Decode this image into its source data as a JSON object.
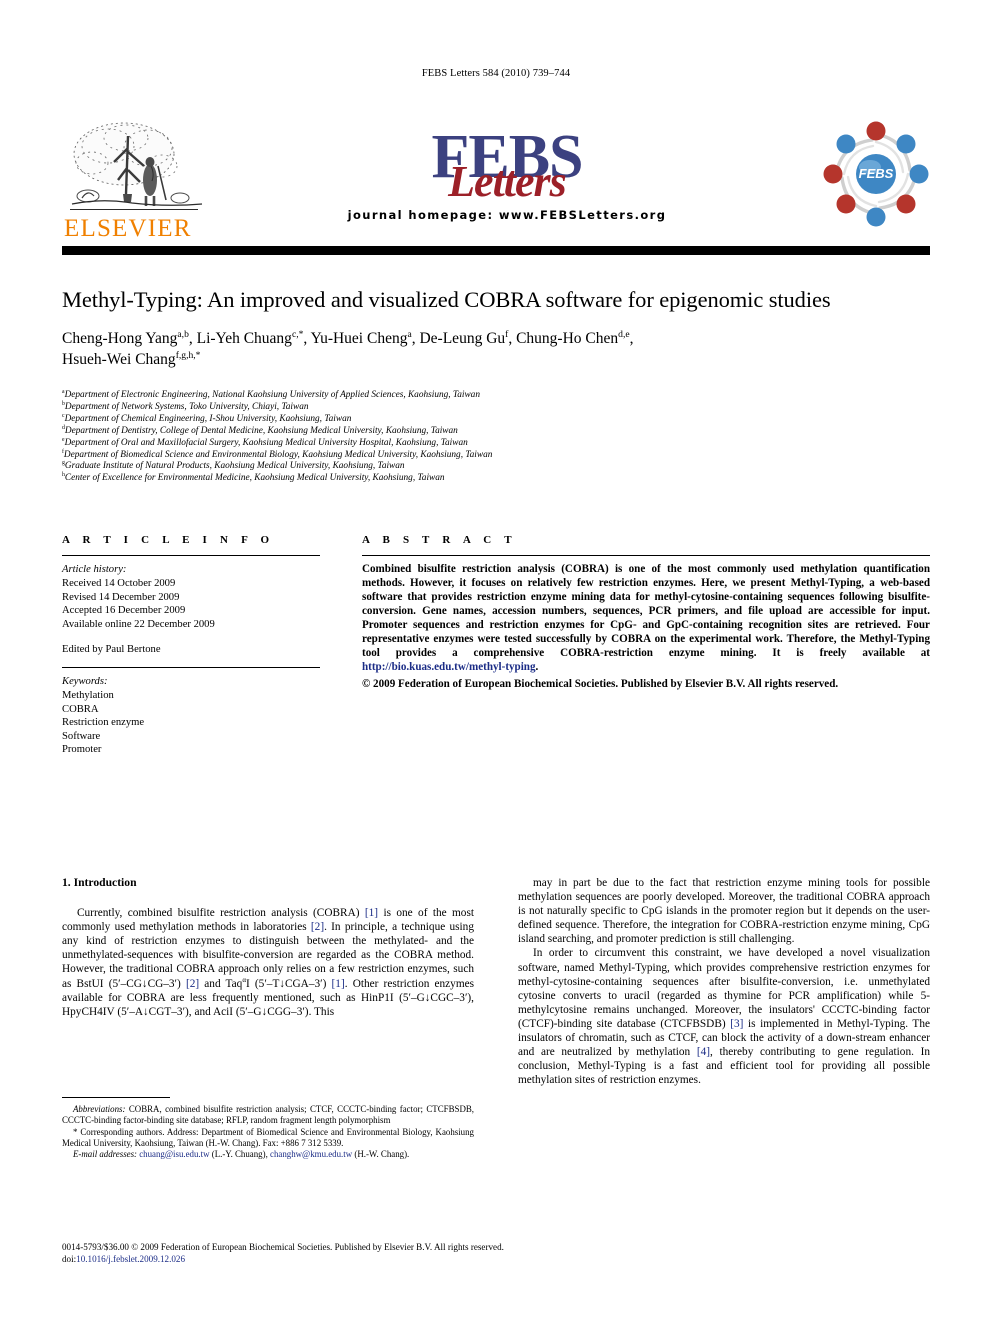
{
  "running_head": "FEBS Letters 584 (2010) 739–744",
  "masthead": {
    "publisher_name": "ELSEVIER",
    "publisher_logo_alt": "elsevier-tree-logo",
    "journal_name_main": "FEBS",
    "journal_name_script": "Letters",
    "homepage_line": "journal homepage: www.FEBSLetters.org",
    "society_mark_text": "FEBS"
  },
  "article": {
    "title": "Methyl-Typing: An improved and visualized COBRA software for epigenomic studies",
    "authors": [
      {
        "name": "Cheng-Hong Yang",
        "marks": "a,b",
        "sep": ", "
      },
      {
        "name": "Li-Yeh Chuang",
        "marks": "c,*",
        "sep": ", "
      },
      {
        "name": "Yu-Huei Cheng",
        "marks": "a",
        "sep": ", "
      },
      {
        "name": "De-Leung Gu",
        "marks": "f",
        "sep": ", "
      },
      {
        "name": "Chung-Ho Chen",
        "marks": "d,e",
        "sep": ","
      },
      {
        "name": "Hsueh-Wei Chang",
        "marks": "f,g,h,*",
        "sep": ""
      }
    ],
    "affiliations": [
      {
        "mark": "a",
        "text": "Department of Electronic Engineering, National Kaohsiung University of Applied Sciences, Kaohsiung, Taiwan"
      },
      {
        "mark": "b",
        "text": "Department of Network Systems, Toko University, Chiayi, Taiwan"
      },
      {
        "mark": "c",
        "text": "Department of Chemical Engineering, I-Shou University, Kaohsiung, Taiwan"
      },
      {
        "mark": "d",
        "text": "Department of Dentistry, College of Dental Medicine, Kaohsiung Medical University, Kaohsiung, Taiwan"
      },
      {
        "mark": "e",
        "text": "Department of Oral and Maxillofacial Surgery, Kaohsiung Medical University Hospital, Kaohsiung, Taiwan"
      },
      {
        "mark": "f",
        "text": "Department of Biomedical Science and Environmental Biology, Kaohsiung Medical University, Kaohsiung, Taiwan"
      },
      {
        "mark": "g",
        "text": "Graduate Institute of Natural Products, Kaohsiung Medical University, Kaohsiung, Taiwan"
      },
      {
        "mark": "h",
        "text": "Center of Excellence for Environmental Medicine, Kaohsiung Medical University, Kaohsiung, Taiwan"
      }
    ]
  },
  "article_info": {
    "heading": "A R T I C L E   I N F O",
    "history_label": "Article history:",
    "history": [
      "Received 14 October 2009",
      "Revised 14 December 2009",
      "Accepted 16 December 2009",
      "Available online 22 December 2009"
    ],
    "editor": "Edited by Paul Bertone",
    "keywords_label": "Keywords:",
    "keywords": [
      "Methylation",
      "COBRA",
      "Restriction enzyme",
      "Software",
      "Promoter"
    ]
  },
  "abstract": {
    "heading": "A B S T R A C T",
    "text_before_link": "Combined bisulfite restriction analysis (COBRA) is one of the most commonly used methylation quantification methods. However, it focuses on relatively few restriction enzymes. Here, we present Methyl-Typing, a web-based software that provides restriction enzyme mining data for methyl-cytosine-containing sequences following bisulfite-conversion. Gene names, accession numbers, sequences, PCR primers, and file upload are accessible for input. Promoter sequences and restriction enzymes for CpG- and GpC-containing recognition sites are retrieved. Four representative enzymes were tested successfully by COBRA on the experimental work. Therefore, the Methyl-Typing tool provides a comprehensive COBRA-restriction enzyme mining. It is freely available at ",
    "link_text": "http://bio.kuas.edu.tw/methyl-typing",
    "text_after_link": ".",
    "copyright": "© 2009 Federation of European Biochemical Societies. Published by Elsevier B.V. All rights reserved."
  },
  "sections": {
    "intro_heading": "1. Introduction",
    "left_paragraph_parts": [
      "Currently, combined bisulfite restriction analysis (COBRA) ",
      "[1]",
      " is one of the most commonly used methylation methods in laboratories ",
      "[2]",
      ". In principle, a technique using any kind of restriction enzymes to distinguish between the methylated- and the unmethylated-sequences with bisulfite-conversion are regarded as the COBRA method. However, the traditional COBRA approach only relies on a few restriction enzymes, such as BstUI (5′–CG↓CG–3′) ",
      "[2]",
      " and Taq",
      "α",
      "I (5′–T↓CGA–3′) ",
      "[1]",
      ". Other restriction enzymes available for COBRA are less frequently mentioned, such as HinP1I (5′–G↓CGC–3′), HpyCH4IV (5′–A↓CGT–3′), and AciI (5′–G↓CGG–3′). This"
    ],
    "right_paragraph_1": "may in part be due to the fact that restriction enzyme mining tools for possible methylation sequences are poorly developed. Moreover, the traditional COBRA approach is not naturally specific to CpG islands in the promoter region but it depends on the user-defined sequence. Therefore, the integration for COBRA-restriction enzyme mining, CpG island searching, and promoter prediction is still challenging.",
    "right_paragraph_2_parts": [
      "In order to circumvent this constraint, we have developed a novel visualization software, named Methyl-Typing, which provides comprehensive restriction enzymes for methyl-cytosine-containing sequences after bisulfite-conversion, i.e. unmethylated cytosine converts to uracil (regarded as thymine for PCR amplification) while 5-methylcytosine remains unchanged. Moreover, the insulators' CCCTC-binding factor (CTCF)-binding site database (CTCFBSDB) ",
      "[3]",
      " is implemented in Methyl-Typing. The insulators of chromatin, such as CTCF, can block the activity of a down-stream enhancer and are neutralized by methylation ",
      "[4]",
      ", thereby contributing to gene regulation. In conclusion, Methyl-Typing is a fast and efficient tool for providing all possible methylation sites of restriction enzymes."
    ]
  },
  "footnotes": {
    "abbreviations_label": "Abbreviations:",
    "abbreviations_text": " COBRA, combined bisulfite restriction analysis; CTCF, CCCTC-binding factor; CTCFBSDB, CCCTC-binding factor-binding site database; RFLP, random fragment length polymorphism",
    "corresponding_marker": "*",
    "corresponding_text": " Corresponding authors. Address: Department of Biomedical Science and Environmental Biology, Kaohsiung Medical University, Kaohsiung, Taiwan (H.-W. Chang). Fax: +886 7 312 5339.",
    "email_label": "E-mail addresses:",
    "email_1": "chuang@isu.edu.tw",
    "email_1_owner": " (L.-Y. Chuang), ",
    "email_2": "changhw@kmu.edu.tw",
    "email_2_owner": " (H.-W. Chang)."
  },
  "colophon": {
    "issn_line": "0014-5793/$36.00 © 2009 Federation of European Biochemical Societies. Published by Elsevier B.V. All rights reserved.",
    "doi_label": "doi:",
    "doi_value": "10.1016/j.febslet.2009.12.026"
  },
  "colors": {
    "elsevier_orange": "#F08000",
    "febs_navy": "#3C4180",
    "febs_red": "#9C2028",
    "link_blue": "#1B2C86",
    "mark_red": "#B5352C",
    "mark_blue": "#3E87C4"
  }
}
